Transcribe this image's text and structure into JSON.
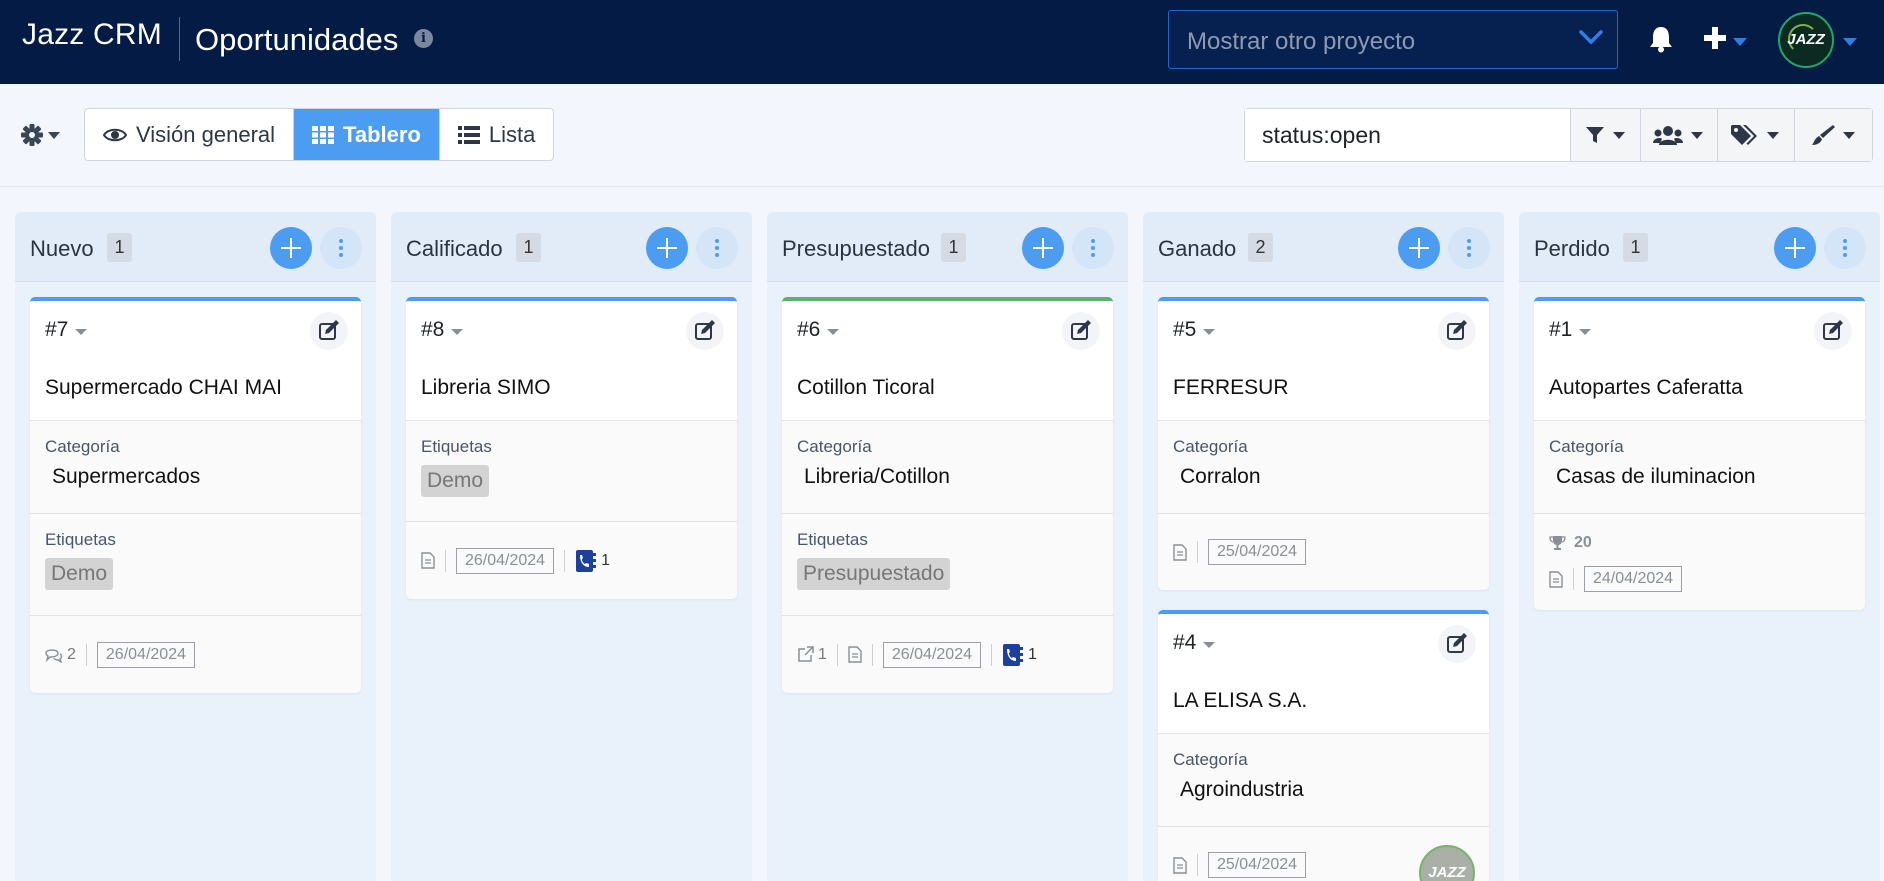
{
  "app": {
    "brand": "Jazz CRM",
    "page_title": "Oportunidades"
  },
  "header": {
    "project_select_placeholder": "Mostrar otro proyecto",
    "avatar_text": "JAZZ",
    "colors": {
      "navbar_bg": "#031b45",
      "accent": "#4c9cf2"
    }
  },
  "toolbar": {
    "views": [
      {
        "label": "Visión general",
        "icon": "eye-icon",
        "active": false
      },
      {
        "label": "Tablero",
        "icon": "grid-icon",
        "active": true
      },
      {
        "label": "Lista",
        "icon": "list-icon",
        "active": false
      }
    ],
    "filter_value": "status:open",
    "filter_buttons": [
      "filter-icon",
      "users-icon",
      "tags-icon",
      "brush-icon"
    ]
  },
  "columns": [
    {
      "title": "Nuevo",
      "count": "1",
      "cards": [
        {
          "id": "#7",
          "title": "Supermercado CHAI MAI",
          "category_label": "Categoría",
          "category": "Supermercados",
          "tags_label": "Etiquetas",
          "tags": [
            "Demo"
          ],
          "comments": "2",
          "date": "26/04/2024"
        }
      ]
    },
    {
      "title": "Calificado",
      "count": "1",
      "cards": [
        {
          "id": "#8",
          "title": "Libreria SIMO",
          "tags_label": "Etiquetas",
          "tags": [
            "Demo"
          ],
          "date": "26/04/2024",
          "contacts": "1"
        }
      ]
    },
    {
      "title": "Presupuestado",
      "count": "1",
      "cards": [
        {
          "id": "#6",
          "title": "Cotillon Ticoral",
          "category_label": "Categoría",
          "category": "Libreria/Cotillon",
          "tags_label": "Etiquetas",
          "tags": [
            "Presupuestado"
          ],
          "links": "1",
          "date": "26/04/2024",
          "contacts": "1"
        }
      ]
    },
    {
      "title": "Ganado",
      "count": "2",
      "cards": [
        {
          "id": "#5",
          "title": "FERRESUR",
          "category_label": "Categoría",
          "category": "Corralon",
          "date": "25/04/2024"
        },
        {
          "id": "#4",
          "title": "LA ELISA S.A.",
          "category_label": "Categoría",
          "category": "Agroindustria",
          "date": "25/04/2024",
          "avatar_text": "JAZZ"
        }
      ]
    },
    {
      "title": "Perdido",
      "count": "1",
      "cards": [
        {
          "id": "#1",
          "title": "Autopartes Caferatta",
          "category_label": "Categoría",
          "category": "Casas de iluminacion",
          "score": "20",
          "date": "24/04/2024"
        }
      ]
    }
  ]
}
